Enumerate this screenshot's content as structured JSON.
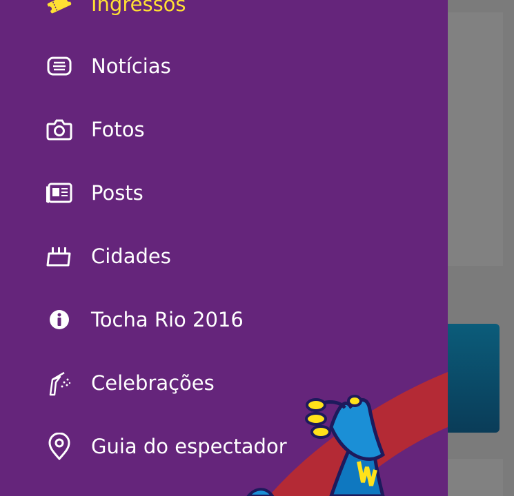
{
  "menu": {
    "items": [
      {
        "label": "Ingressos",
        "icon": "ticket-icon",
        "active": true
      },
      {
        "label": "Notícias",
        "icon": "news-icon"
      },
      {
        "label": "Fotos",
        "icon": "camera-icon"
      },
      {
        "label": "Posts",
        "icon": "newspaper-icon"
      },
      {
        "label": "Cidades",
        "icon": "city-icon"
      },
      {
        "label": "Tocha Rio 2016",
        "icon": "info-icon"
      },
      {
        "label": "Celebrações",
        "icon": "celebration-icon"
      },
      {
        "label": "Guia do espectador",
        "icon": "map-pin-icon"
      }
    ]
  },
  "colors": {
    "drawer_bg": "#65257b",
    "active_text": "#ffe033",
    "text": "#ffffff",
    "overlay_gray": "#7b7b7b"
  }
}
